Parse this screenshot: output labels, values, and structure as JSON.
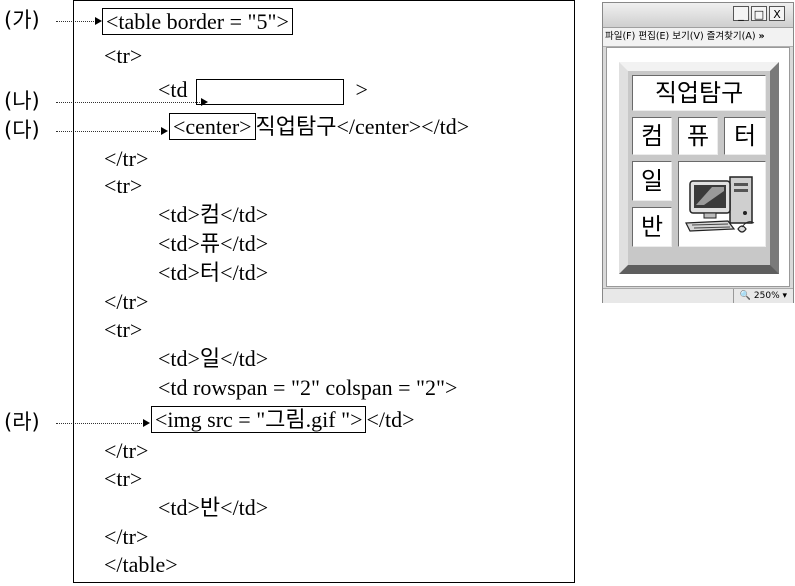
{
  "labels": {
    "ga": "(가)",
    "na": "(나)",
    "da": "(다)",
    "ra": "(라)"
  },
  "code": {
    "table_open": "<table border = \"5\">",
    "tr_open_1": "<tr>",
    "td_open_start": "<td",
    "td_open_end": ">",
    "center_tag": "<center>",
    "center_rest": "직업탐구</center></td>",
    "tr_close_1": "</tr>",
    "tr_open_2": "<tr>",
    "td_keom": "<td>컴</td>",
    "td_pyu": "<td>퓨</td>",
    "td_teo": "<td>터</td>",
    "tr_close_2": "</tr>",
    "tr_open_3": "<tr>",
    "td_il": "<td>일</td>",
    "td_rowspan": "<td rowspan = \"2\" colspan = \"2\">",
    "img_tag": "<img src = \"그림.gif \">",
    "img_rest": "</td>",
    "tr_close_3": "</tr>",
    "tr_open_4": "<tr>",
    "td_ban": "<td>반</td>",
    "tr_close_4": "</tr>",
    "table_close": "</table>"
  },
  "browser": {
    "btn_min": "_",
    "btn_max": "□",
    "btn_close": "X",
    "menu": [
      "파일(F)",
      "편집(E)",
      "보기(V)",
      "즐겨찾기(A)",
      "»"
    ],
    "zoom": "250% ▾",
    "zoom_icon": "magnifier-icon",
    "table": {
      "header": "직업탐구",
      "row2": [
        "컴",
        "퓨",
        "터"
      ],
      "row3": "일",
      "row4": "반",
      "image": "computer-icon"
    }
  }
}
